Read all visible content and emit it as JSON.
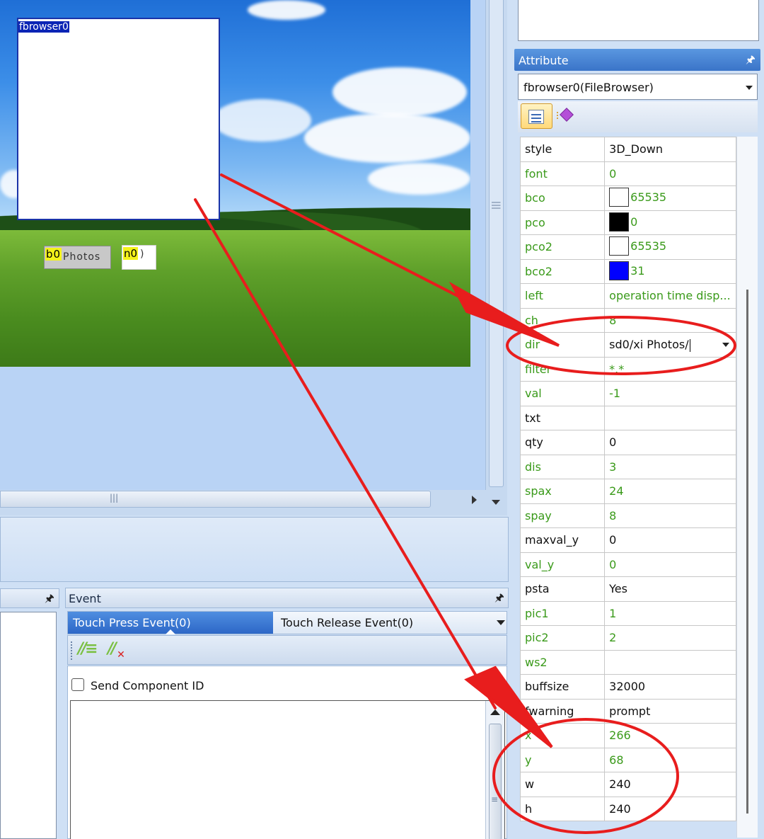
{
  "canvas": {
    "fbrowser_tag": "fbrowser0",
    "button_tag": "b0",
    "button_label": "Photos",
    "number_tag": "n0",
    "number_tail": ")"
  },
  "event_panel": {
    "title": "Event",
    "tabs": [
      {
        "label": "Touch Press Event(0)",
        "active": true
      },
      {
        "label": "Touch Release Event(0)",
        "active": false
      }
    ],
    "checkbox_label": "Send Component ID",
    "checkbox_checked": false
  },
  "attribute_panel": {
    "title": "Attribute",
    "selected_component": "fbrowser0(FileBrowser)",
    "rows": [
      {
        "key": "style",
        "value": "3D_Down",
        "color": "#111111"
      },
      {
        "key": "font",
        "value": "0",
        "color": "#3a9a1a"
      },
      {
        "key": "bco",
        "value": "65535",
        "swatch": "#ffffff",
        "color": "#3a9a1a"
      },
      {
        "key": "pco",
        "value": "0",
        "swatch": "#000000",
        "color": "#3a9a1a"
      },
      {
        "key": "pco2",
        "value": "65535",
        "swatch": "#ffffff",
        "color": "#3a9a1a"
      },
      {
        "key": "bco2",
        "value": "31",
        "swatch": "#0000ff",
        "color": "#3a9a1a"
      },
      {
        "key": "left",
        "value": "operation time disp...",
        "color": "#3a9a1a"
      },
      {
        "key": "ch",
        "value": "8",
        "color": "#3a9a1a"
      },
      {
        "key": "dir",
        "value": "sd0/xi Photos/",
        "color": "#3a9a1a",
        "editing": true
      },
      {
        "key": "filter",
        "value": "*.*",
        "color": "#3a9a1a"
      },
      {
        "key": "val",
        "value": "-1",
        "color": "#3a9a1a"
      },
      {
        "key": "txt",
        "value": "",
        "color": "#111111"
      },
      {
        "key": "qty",
        "value": "0",
        "color": "#111111"
      },
      {
        "key": "dis",
        "value": "3",
        "color": "#3a9a1a"
      },
      {
        "key": "spax",
        "value": "24",
        "color": "#3a9a1a"
      },
      {
        "key": "spay",
        "value": "8",
        "color": "#3a9a1a"
      },
      {
        "key": "maxval_y",
        "value": "0",
        "color": "#111111"
      },
      {
        "key": "val_y",
        "value": "0",
        "color": "#3a9a1a"
      },
      {
        "key": "psta",
        "value": "Yes",
        "color": "#111111"
      },
      {
        "key": "pic1",
        "value": "1",
        "color": "#3a9a1a"
      },
      {
        "key": "pic2",
        "value": "2",
        "color": "#3a9a1a"
      },
      {
        "key": "ws2",
        "value": "",
        "color": "#3a9a1a"
      },
      {
        "key": "buffsize",
        "value": "32000",
        "color": "#111111"
      },
      {
        "key": "fwarning",
        "value": "prompt",
        "color": "#111111"
      },
      {
        "key": "x",
        "value": "266",
        "color": "#3a9a1a"
      },
      {
        "key": "y",
        "value": "68",
        "color": "#3a9a1a"
      },
      {
        "key": "w",
        "value": "240",
        "color": "#111111"
      },
      {
        "key": "h",
        "value": "240",
        "color": "#111111"
      }
    ]
  },
  "annotation_color": "#e81d1d"
}
